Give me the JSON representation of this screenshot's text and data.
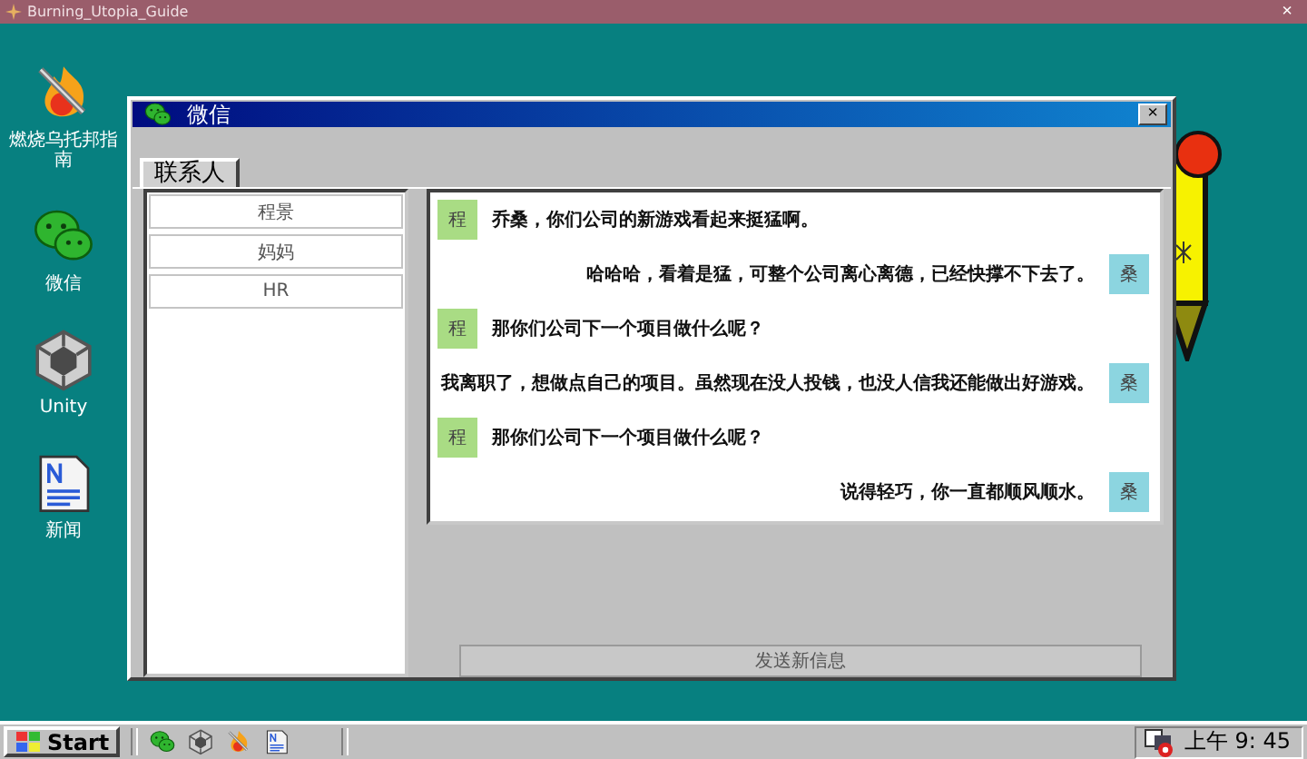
{
  "app_titlebar": {
    "title": "Burning_Utopia_Guide",
    "close": "×"
  },
  "desktop_icons": [
    {
      "kind": "fire",
      "label": "燃烧乌托邦指南"
    },
    {
      "kind": "wechat",
      "label": "微信"
    },
    {
      "kind": "unity",
      "label": "Unity"
    },
    {
      "kind": "news",
      "label": "新闻"
    }
  ],
  "window": {
    "title": "微信",
    "close": "×"
  },
  "tabs": [
    {
      "label": "联系人",
      "selected": true
    }
  ],
  "contacts": [
    {
      "name": "程景"
    },
    {
      "name": "妈妈"
    },
    {
      "name": "HR"
    }
  ],
  "messages": [
    {
      "kind": "incoming",
      "avatar": "程",
      "text": "乔桑，你们公司的新游戏看起来挺猛啊。"
    },
    {
      "kind": "outgoing",
      "avatar": "桑",
      "text": "哈哈哈，看着是猛，可整个公司离心离德，已经快撑不下去了。"
    },
    {
      "kind": "incoming",
      "avatar": "程",
      "text": "那你们公司下一个项目做什么呢？"
    },
    {
      "kind": "outgoing",
      "avatar": "桑",
      "text": "我离职了，想做点自己的项目。虽然现在没人投钱，也没人信我还能做出好游戏。"
    },
    {
      "kind": "incoming",
      "avatar": "程",
      "text": "那你们公司下一个项目做什么呢？"
    },
    {
      "kind": "outgoing",
      "avatar": "桑",
      "text": "说得轻巧，你一直都顺风顺水。"
    }
  ],
  "send_button": "发送新信息",
  "taskbar": {
    "start": "Start",
    "quick_launch": [
      {
        "kind": "wechat"
      },
      {
        "kind": "unity"
      },
      {
        "kind": "fire"
      },
      {
        "kind": "news"
      }
    ],
    "clock": "上午 9: 45"
  }
}
